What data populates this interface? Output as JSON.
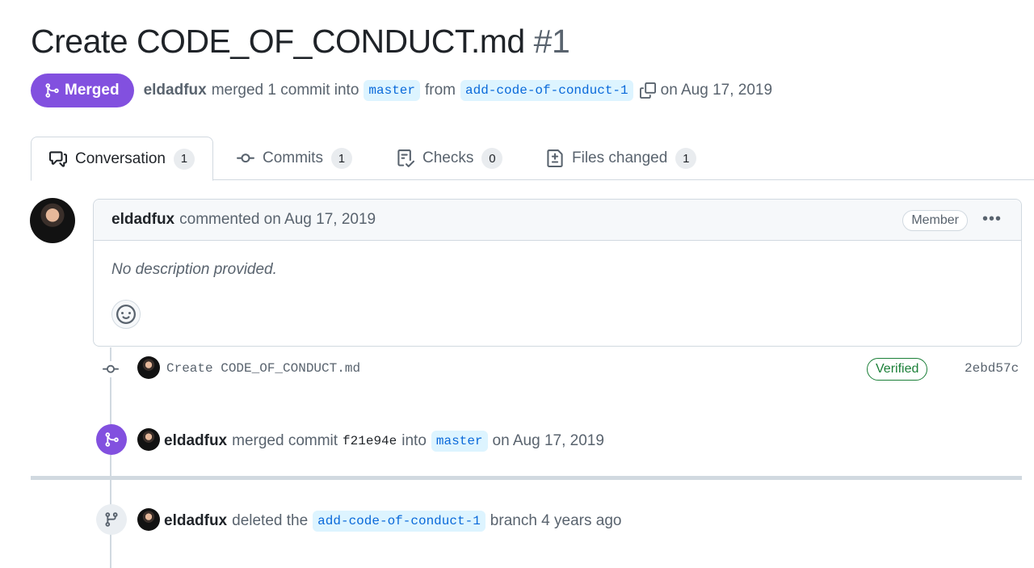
{
  "pr": {
    "title": "Create CODE_OF_CONDUCT.md",
    "number": "#1",
    "state": "Merged",
    "author": "eldadfux",
    "merge_text": "merged 1 commit into",
    "base_branch": "master",
    "from_text": "from",
    "head_branch": "add-code-of-conduct-1",
    "date_text": "on Aug 17, 2019"
  },
  "tabs": [
    {
      "label": "Conversation",
      "count": "1",
      "icon": "comment-discussion-icon"
    },
    {
      "label": "Commits",
      "count": "1",
      "icon": "git-commit-icon"
    },
    {
      "label": "Checks",
      "count": "0",
      "icon": "checklist-icon"
    },
    {
      "label": "Files changed",
      "count": "1",
      "icon": "file-diff-icon"
    }
  ],
  "comment": {
    "author": "eldadfux",
    "action": "commented on Aug 17, 2019",
    "role": "Member",
    "menu": "•••",
    "body": "No description provided."
  },
  "commit": {
    "message": "Create CODE_OF_CONDUCT.md",
    "verified": "Verified",
    "sha": "2ebd57c"
  },
  "events": {
    "merged": {
      "author": "eldadfux",
      "text1": "merged commit",
      "sha": "f21e94e",
      "text2": "into",
      "branch": "master",
      "text3": "on Aug 17, 2019"
    },
    "deleted": {
      "author": "eldadfux",
      "text1": "deleted the",
      "branch": "add-code-of-conduct-1",
      "text2": "branch 4 years ago"
    }
  },
  "colors": {
    "merged": "#8250df",
    "link": "#0969da",
    "verified": "#1a7f37"
  }
}
